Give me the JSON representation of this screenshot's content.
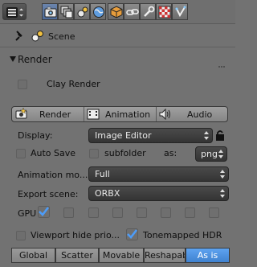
{
  "header": {
    "editor_menu_icon": "properties-editor-icon",
    "context_tabs": [
      {
        "name": "render",
        "icon": "camera-icon",
        "active": true
      },
      {
        "name": "render-layers",
        "icon": "layers-icon",
        "active": false
      },
      {
        "name": "scene",
        "icon": "scene-icon",
        "active": false
      },
      {
        "name": "world",
        "icon": "world-icon",
        "active": false
      },
      {
        "name": "object",
        "icon": "cube-icon",
        "active": false
      },
      {
        "name": "constraints",
        "icon": "chain-icon",
        "active": false
      },
      {
        "name": "modifiers",
        "icon": "wrench-icon",
        "active": false
      },
      {
        "name": "texture",
        "icon": "checker-icon",
        "active": false
      },
      {
        "name": "particles",
        "icon": "particles-icon",
        "active": false
      }
    ]
  },
  "context": {
    "scene_label": "Scene"
  },
  "panel": {
    "title": "Render",
    "clay_render": {
      "label": "Clay Render",
      "checked": false
    },
    "buttons": {
      "render": "Render",
      "animation": "Animation",
      "audio": "Audio"
    },
    "display": {
      "label": "Display:",
      "value": "Image Editor"
    },
    "auto_save": {
      "label": "Auto Save",
      "checked": false
    },
    "subfolder": {
      "label": "subfolder",
      "checked": false
    },
    "as_label": "as:",
    "format": {
      "value": "png"
    },
    "animation_mode": {
      "label": "Animation mo...",
      "value": "Full"
    },
    "export_scene": {
      "label": "Export scene:",
      "value": "ORBX"
    },
    "gpu": {
      "label": "GPU",
      "states": [
        true,
        false,
        false,
        false,
        false,
        false,
        false,
        false
      ]
    },
    "viewport_hide": {
      "label": "Viewport hide prio...",
      "checked": false
    },
    "tonemapped_hdr": {
      "label": "Tonemapped HDR",
      "checked": true
    },
    "tabs": [
      {
        "label": "Global",
        "active": false
      },
      {
        "label": "Scatter",
        "active": false
      },
      {
        "label": "Movable",
        "active": false
      },
      {
        "label": "Reshapabl",
        "active": false
      },
      {
        "label": "As is",
        "active": true
      }
    ]
  },
  "colors": {
    "accent": "#5b9ef0",
    "check": "#4d9cf8"
  }
}
